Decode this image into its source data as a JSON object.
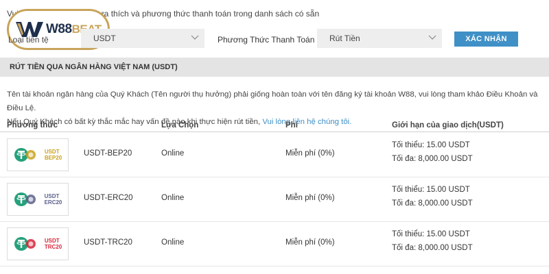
{
  "intro_text": "Vui lòng chọn loại tiền tệ ưa thích và phương thức thanh toán trong danh sách có sẵn",
  "logo": {
    "part1": "W88",
    "part2": "BEAT"
  },
  "filter": {
    "currency_label": "Loại tiền tệ",
    "currency_value": "USDT",
    "method_label": "Phương Thức Thanh Toán",
    "method_value": "Rút Tiền",
    "confirm_label": "XÁC NHẬN"
  },
  "section_title": "RÚT TIỀN QUA NGÂN HÀNG VIỆT NAM (USDT)",
  "notice": {
    "line1": "Tên tài khoản ngân hàng của Quý Khách (Tên người thụ hưởng) phải giống hoàn toàn với tên đăng ký tài khoản W88, vui lòng tham khảo Điều Khoản và Điều Lệ.",
    "line2_prefix": "Nếu Quý Khách có bất kỳ thắc mắc hay vấn đề nào khi thực hiện rút tiền, ",
    "line2_link": "Vui lòng liên hệ chúng tôi."
  },
  "table": {
    "headers": [
      "Phương thức",
      "Lựa Chọn",
      "Phí",
      "Giới hạn của giao dịch(USDT)"
    ],
    "rows": [
      {
        "coin_line1": "USDT",
        "coin_line2": "BEP20",
        "coin_color": "#c9a21f",
        "method": "USDT-BEP20",
        "option": "Online",
        "fee": "Miễn phí (0%)",
        "min": "Tối thiểu: 15.00 USDT",
        "max": "Tối đa: 8,000.00 USDT"
      },
      {
        "coin_line1": "USDT",
        "coin_line2": "ERC20",
        "coin_color": "#5b5f8a",
        "method": "USDT-ERC20",
        "option": "Online",
        "fee": "Miễn phí (0%)",
        "min": "Tối thiểu: 15.00 USDT",
        "max": "Tối đa: 8,000.00 USDT"
      },
      {
        "coin_line1": "USDT",
        "coin_line2": "TRC20",
        "coin_color": "#d6263a",
        "method": "USDT-TRC20",
        "option": "Online",
        "fee": "Miễn phí (0%)",
        "min": "Tối thiểu: 15.00 USDT",
        "max": "Tối đa: 8,000.00 USDT"
      }
    ]
  },
  "colors": {
    "accent": "#3f90c6",
    "tether_green": "#26a17b",
    "logo_gold": "#c8a45a"
  }
}
